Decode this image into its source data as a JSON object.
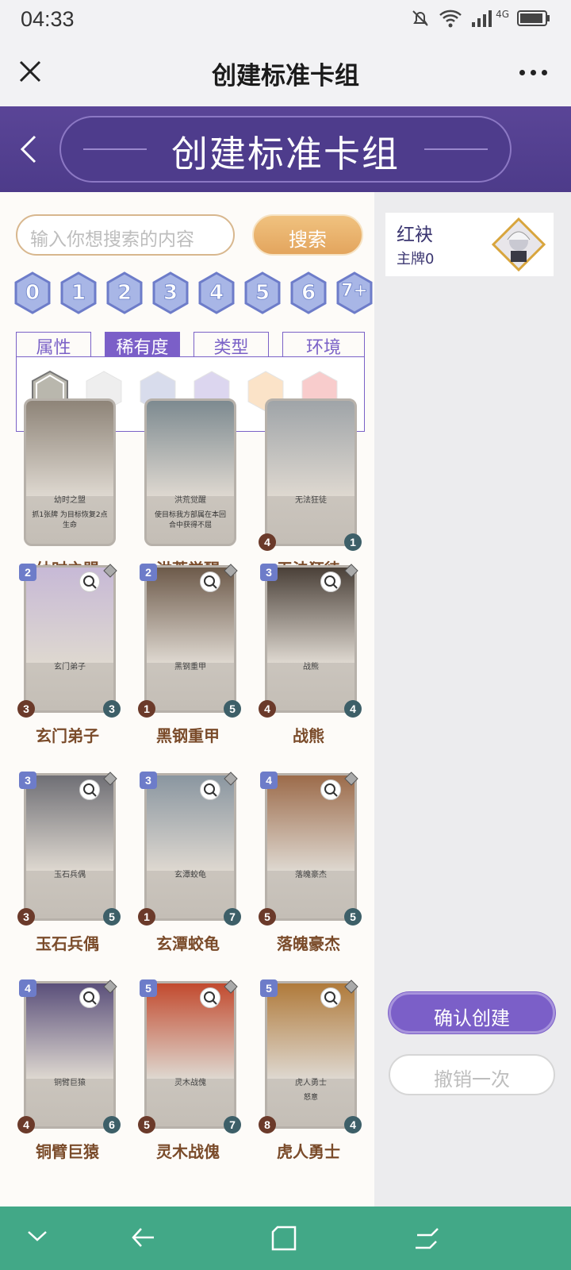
{
  "status": {
    "time": "04:33",
    "network": "4G"
  },
  "navbar": {
    "title": "创建标准卡组"
  },
  "banner": {
    "title": "创建标准卡组"
  },
  "search": {
    "placeholder": "输入你想搜索的内容",
    "button": "搜索"
  },
  "cost_filters": [
    "0",
    "1",
    "2",
    "3",
    "4",
    "5",
    "6",
    "7+"
  ],
  "tabs": [
    "属性",
    "稀有度",
    "类型",
    "环境"
  ],
  "active_tab": "稀有度",
  "rarity_colors": [
    "#b9b7ad",
    "#eeeeee",
    "#d8dcec",
    "#dcd6ef",
    "#fbe3c8",
    "#f8cccc"
  ],
  "cards": [
    {
      "name": "幼时之盟",
      "art_title": "幼时之盟",
      "text": "抓1张牌 为目标恢复2点生命",
      "cost": "",
      "atk": "",
      "hp": ""
    },
    {
      "name": "洪荒觉醒",
      "art_title": "洪荒觉醒",
      "text": "使目标我方部属在本回合中获得不屈",
      "cost": "",
      "atk": "",
      "hp": ""
    },
    {
      "name": "无法狂徒",
      "art_title": "无法狂徒",
      "text": "",
      "cost": "",
      "atk": "4",
      "hp": "1"
    },
    {
      "name": "玄门弟子",
      "art_title": "玄门弟子",
      "text": "",
      "cost": "2",
      "atk": "3",
      "hp": "3"
    },
    {
      "name": "黑钢重甲",
      "art_title": "黑钢重甲",
      "text": "",
      "cost": "2",
      "atk": "1",
      "hp": "5"
    },
    {
      "name": "战熊",
      "art_title": "战熊",
      "text": "",
      "cost": "3",
      "atk": "4",
      "hp": "4"
    },
    {
      "name": "玉石兵偶",
      "art_title": "玉石兵偶",
      "text": "",
      "cost": "3",
      "atk": "3",
      "hp": "5"
    },
    {
      "name": "玄潭蛟龟",
      "art_title": "玄潭蛟龟",
      "text": "",
      "cost": "3",
      "atk": "1",
      "hp": "7"
    },
    {
      "name": "落魄豪杰",
      "art_title": "落魄豪杰",
      "text": "",
      "cost": "4",
      "atk": "5",
      "hp": "5"
    },
    {
      "name": "铜臂巨猿",
      "art_title": "铜臂巨猿",
      "text": "",
      "cost": "4",
      "atk": "4",
      "hp": "6"
    },
    {
      "name": "灵木战傀",
      "art_title": "灵木战傀",
      "text": "",
      "cost": "5",
      "atk": "5",
      "hp": "7"
    },
    {
      "name": "虎人勇士",
      "art_title": "虎人勇士",
      "text": "怒意",
      "cost": "5",
      "atk": "8",
      "hp": "4"
    }
  ],
  "deck": {
    "name": "红袂",
    "sub": "主牌0"
  },
  "actions": {
    "confirm": "确认创建",
    "undo": "撤销一次"
  }
}
